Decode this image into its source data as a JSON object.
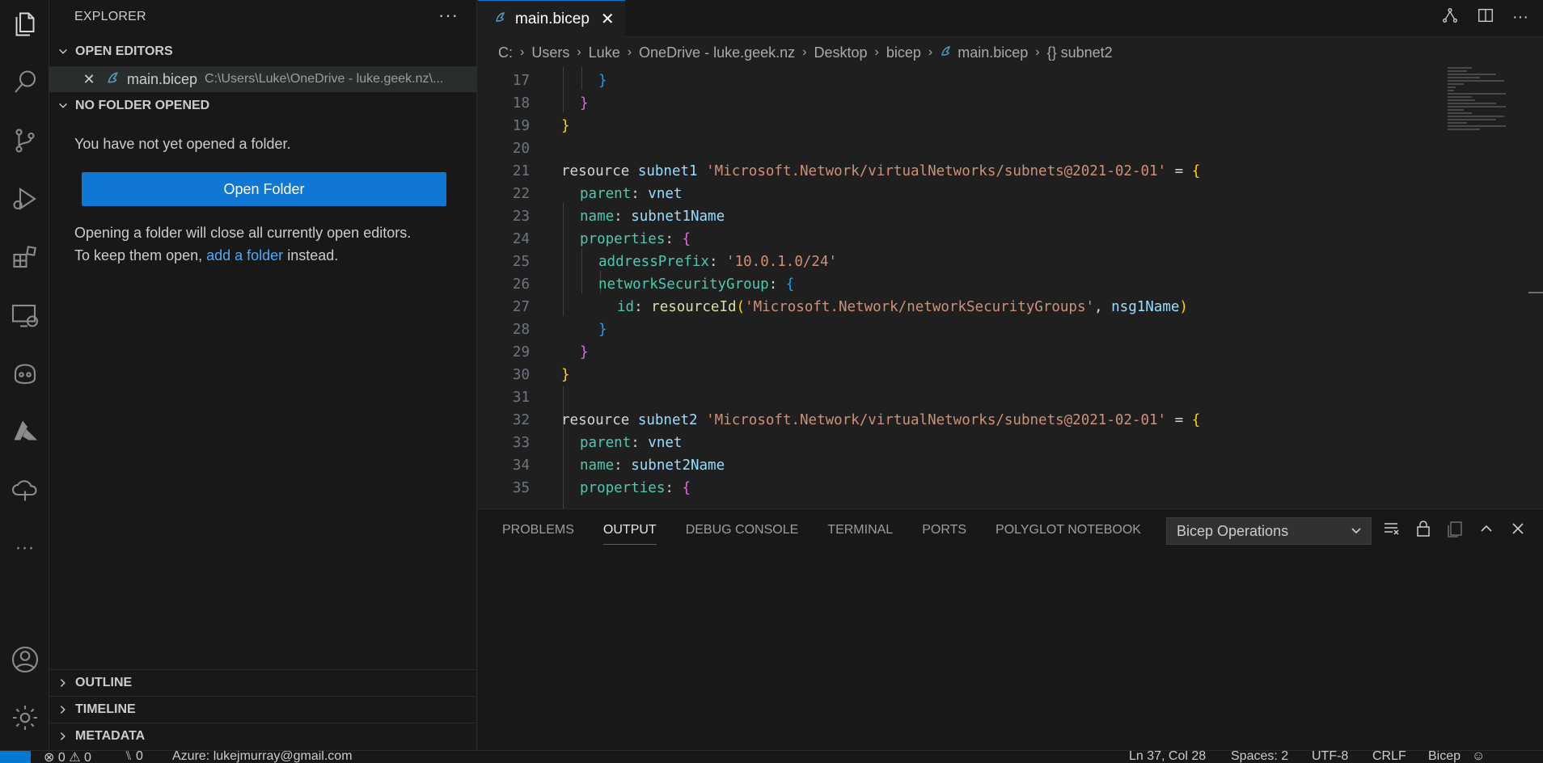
{
  "sidebar": {
    "title": "EXPLORER",
    "more": "···",
    "open_editors": {
      "heading": "OPEN EDITORS",
      "file_name": "main.bicep",
      "file_path": "C:\\Users\\Luke\\OneDrive - luke.geek.nz\\..."
    },
    "no_folder": {
      "heading": "NO FOLDER OPENED",
      "message": "You have not yet opened a folder.",
      "button": "Open Folder",
      "warning_line1": "Opening a folder will close all currently open editors.",
      "warning_prefix": "To keep them open, ",
      "warning_link": "add a folder",
      "warning_suffix": " instead."
    },
    "outline": "OUTLINE",
    "timeline": "TIMELINE",
    "metadata": "METADATA"
  },
  "tab": {
    "name": "main.bicep",
    "close": "✕"
  },
  "breadcrumb": [
    "C:",
    "Users",
    "Luke",
    "OneDrive - luke.geek.nz",
    "Desktop",
    "bicep",
    "main.bicep",
    "{} subnet2"
  ],
  "code": [
    {
      "n": "17"
    },
    {
      "n": "18"
    },
    {
      "n": "19"
    },
    {
      "n": "20"
    },
    {
      "n": "21"
    },
    {
      "n": "22"
    },
    {
      "n": "23"
    },
    {
      "n": "24"
    },
    {
      "n": "25"
    },
    {
      "n": "26"
    },
    {
      "n": "27"
    },
    {
      "n": "28"
    },
    {
      "n": "29"
    },
    {
      "n": "30"
    },
    {
      "n": "31"
    },
    {
      "n": "32"
    },
    {
      "n": "33"
    },
    {
      "n": "34"
    },
    {
      "n": "35"
    }
  ],
  "panel": {
    "tabs": [
      "PROBLEMS",
      "OUTPUT",
      "DEBUG CONSOLE",
      "TERMINAL",
      "PORTS",
      "POLYGLOT NOTEBOOK"
    ],
    "active_tab": "OUTPUT",
    "channel": "Bicep Operations"
  },
  "status": {
    "errors": "⊗ 0 ⚠ 0",
    "ports": "⑊ 0",
    "azure": "Azure: lukejmurray@gmail.com",
    "position": "Ln 37, Col 28",
    "spaces": "Spaces: 2",
    "encoding": "UTF-8",
    "eol": "CRLF",
    "language": "Bicep"
  }
}
